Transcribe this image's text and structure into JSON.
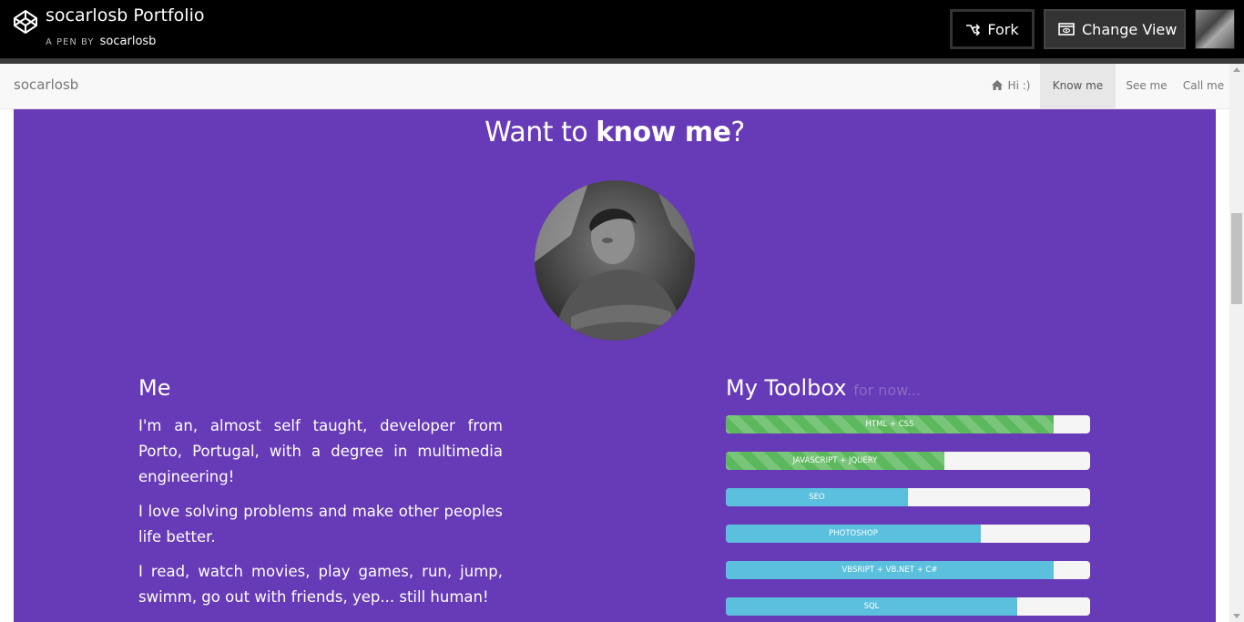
{
  "codepen": {
    "title": "socarlosb Portfolio",
    "byline_prefix": "A PEN BY",
    "author": "socarlosb",
    "fork_label": "Fork",
    "change_view_label": "Change View"
  },
  "navbar": {
    "brand": "socarlosb",
    "items": [
      {
        "label": "Hi :)",
        "icon": "home-icon",
        "active": false
      },
      {
        "label": "Know me",
        "active": true
      },
      {
        "label": "See me",
        "active": false
      },
      {
        "label": "Call me",
        "active": false
      }
    ]
  },
  "section": {
    "heading_prefix": "Want to ",
    "heading_bold": "know me",
    "heading_suffix": "?",
    "background": "#673ab7",
    "me": {
      "title": "Me",
      "paragraphs": [
        "I'm an, almost self taught, developer from Porto, Portugal, with a degree in multimedia engineering!",
        "I love solving problems and make other peoples life better.",
        "I read, watch movies, play games, run, jump, swimm, go out with friends, yep... still human!"
      ]
    },
    "toolbox": {
      "title": "My Toolbox",
      "subtitle": "for now...",
      "skills": [
        {
          "label": "HTML + CSS",
          "percent": 90,
          "style": "striped",
          "color": "#5cb85c"
        },
        {
          "label": "JAVASCRIPT + JQUERY",
          "percent": 60,
          "style": "striped",
          "color": "#5cb85c"
        },
        {
          "label": "SEO",
          "percent": 50,
          "style": "info",
          "color": "#5bc0de"
        },
        {
          "label": "PHOTOSHOP",
          "percent": 70,
          "style": "info",
          "color": "#5bc0de"
        },
        {
          "label": "VBSRIPT + VB.NET + C#",
          "percent": 90,
          "style": "info",
          "color": "#5bc0de"
        },
        {
          "label": "SQL",
          "percent": 80,
          "style": "info",
          "color": "#5bc0de"
        }
      ]
    }
  }
}
